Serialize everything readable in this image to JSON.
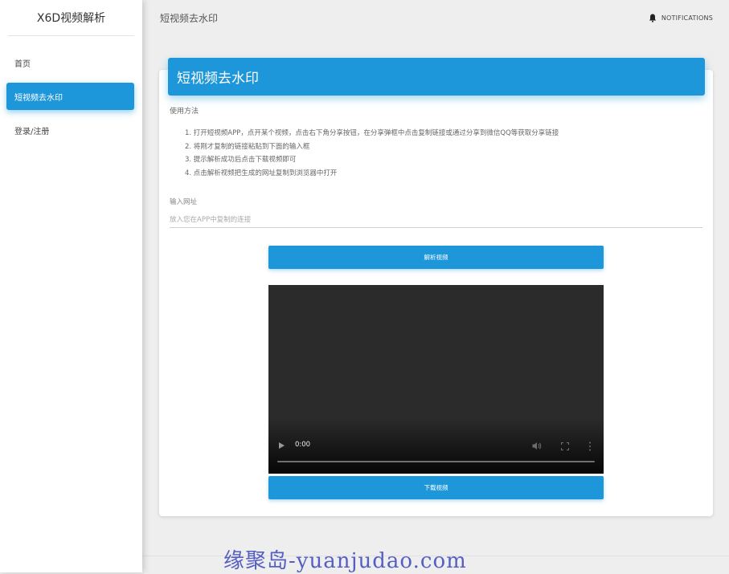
{
  "sidebar": {
    "brand": "X6D视频解析",
    "items": [
      {
        "label": "首页",
        "active": false
      },
      {
        "label": "短视频去水印",
        "active": true
      },
      {
        "label": "登录/注册",
        "active": false
      }
    ]
  },
  "topbar": {
    "title": "短视频去水印",
    "notifications_label": "NOTIFICATIONS",
    "notifications_icon": "bell-icon"
  },
  "card": {
    "header": "短视频去水印",
    "usage_title": "使用方法",
    "steps": [
      "1. 打开短视频APP，点开某个视频，点击右下角分享按钮，在分享弹框中点击复制链接或通过分享到微信QQ等获取分享链接",
      "2. 将刚才复制的链接粘贴到下面的输入框",
      "3. 提示解析成功后点击下载视频即可",
      "4. 点击解析视频把生成的网址复制到浏览器中打开"
    ],
    "input_label": "输入网址",
    "input_placeholder": "放入您在APP中复制的连接",
    "input_value": "",
    "parse_button": "解析视频",
    "download_button": "下载视频",
    "video": {
      "time": "0:00",
      "progress": 0
    }
  },
  "watermark": "缘聚岛-yuanjudao.com",
  "colors": {
    "accent": "#1e97da",
    "page_bg": "#eeeeee",
    "video_bg": "#2b2b2b"
  }
}
